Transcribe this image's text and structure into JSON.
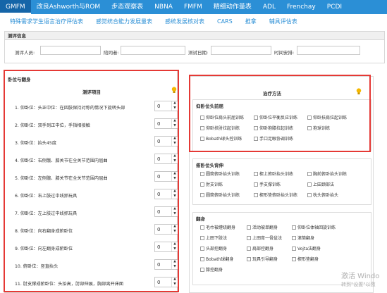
{
  "top_tabs": [
    "GMFM",
    "改良Ashworth与ROM",
    "步态观察表",
    "NBNA",
    "FMFM",
    "精细动作量表",
    "ADL",
    "Frenchay",
    "PCDI"
  ],
  "sub_tabs": [
    "特殊需求学生语言治疗评估表",
    "感觉统合能力发展量表",
    "感统发展核对表",
    "CARS",
    "推拿",
    "辅具评估表"
  ],
  "info": {
    "header": "测评信息",
    "fields": [
      {
        "label": "测评人员:",
        "value": ""
      },
      {
        "label": "陪同者:",
        "value": ""
      },
      {
        "label": "测试日期:",
        "value": ""
      },
      {
        "label": "时间安排:",
        "value": ""
      }
    ]
  },
  "left_panel": {
    "title": "卧位与翻身",
    "column_header": "测评项目",
    "items": [
      {
        "label": "1. 仰卧位：头正中位：在四肢保持对称的情况下旋转头部",
        "value": "0"
      },
      {
        "label": "2. 仰卧位：双手到正中位，手指相接触",
        "value": "0"
      },
      {
        "label": "3. 仰卧位：抬头45度",
        "value": "0"
      },
      {
        "label": "4. 仰卧位：右侧髋、膝关节在全关节范围内屈曲",
        "value": "0"
      },
      {
        "label": "5. 仰卧位：左侧髋、膝关节在全关节范围内屈曲",
        "value": "0"
      },
      {
        "label": "6. 仰卧位：右上肢过中线抓玩具",
        "value": "0"
      },
      {
        "label": "7. 仰卧位：左上肢过中线抓玩具",
        "value": "0"
      },
      {
        "label": "8. 仰卧位：向右翻身成俯卧位",
        "value": "0"
      },
      {
        "label": "9. 仰卧位：向左翻身成俯卧位",
        "value": "0"
      },
      {
        "label": "10. 俯卧位：竖直抬头",
        "value": "0"
      },
      {
        "label": "11. 肘支撑成俯卧位：头抬高，肘部伸展，胸部离开床面",
        "value": "0"
      }
    ]
  },
  "right_panel": {
    "column_header": "治疗方法",
    "groups": [
      {
        "title": "仰卧位头前屈",
        "options": [
          "仰卧位肩头前屈训练",
          "仰卧位平衡反应训练",
          "仰卧扶肩拉起训练",
          "仰卧扶肘拉起训练",
          "仰卧抱膝拉起训练",
          "抱球训练",
          "Bobath球头控训练",
          "手口足眼协调训练"
        ]
      },
      {
        "title": "俯卧位头背伸",
        "options": [
          "圆筒俯卧抬头训练",
          "楔上俯卧抬头训练",
          "胸前俯卧抬头训练",
          "肘支训练",
          "手支撑训练",
          "上田颈部法",
          "圆筒俯卧抬头训练",
          "楔形垫俯卧抬头训练",
          "枕头俯卧抬头"
        ]
      },
      {
        "title": "翻身",
        "options": [
          "毛巾被缠绕翻身",
          "活动被单翻身",
          "仰卧位体轴回旋训练",
          "上田下肢法",
          "上田育一骨盆法",
          "滚筒翻身",
          "头部控翻身",
          "肩部控翻身",
          "Vojta法翻身",
          "Bobath球翻身",
          "玩具引导翻身",
          "楔形垫翻身",
          "膝控翻身"
        ]
      }
    ]
  },
  "watermark": {
    "line1": "激活 Windo",
    "line2": "转到\"设置\"以激"
  },
  "colors": {
    "tab_bar": "#2b8fd6",
    "tab_active": "#1565a8",
    "link": "#2b8fd6",
    "highlight": "#e53935"
  }
}
